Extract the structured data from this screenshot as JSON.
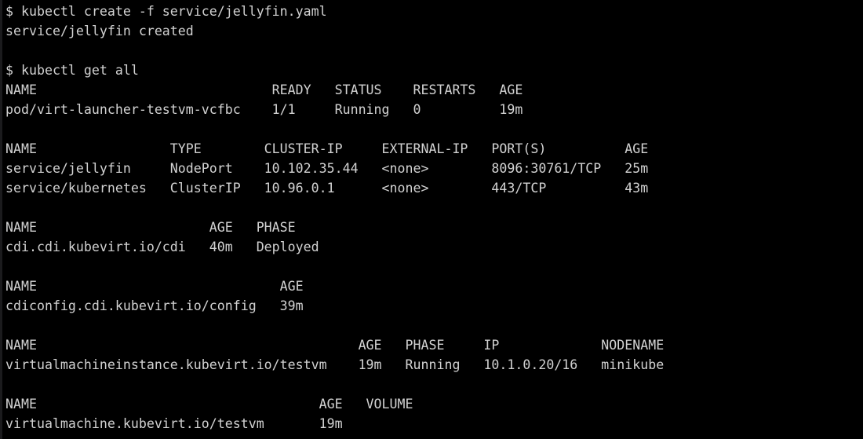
{
  "terminal": {
    "title": "kubectl terminal session",
    "background_color": "#000000",
    "foreground_color": "#d2d2d2",
    "prompt_symbol": "$",
    "columns": 96,
    "rows": 22,
    "char_width": 11.17,
    "line_height": 25
  },
  "session": {
    "commands": [
      {
        "prompt": "$",
        "command": "kubectl create -f service/jellyfin.yaml"
      },
      {
        "prompt": "$",
        "command": "kubectl get all"
      }
    ],
    "outputs": {
      "create_result": "service/jellyfin created"
    }
  },
  "lines": [
    "$ kubectl create -f service/jellyfin.yaml",
    "service/jellyfin created",
    "",
    "$ kubectl get all",
    "NAME                              READY   STATUS    RESTARTS   AGE",
    "pod/virt-launcher-testvm-vcfbc    1/1     Running   0          19m",
    "",
    "NAME                 TYPE        CLUSTER-IP     EXTERNAL-IP   PORT(S)          AGE",
    "service/jellyfin     NodePort    10.102.35.44   <none>        8096:30761/TCP   25m",
    "service/kubernetes   ClusterIP   10.96.0.1      <none>        443/TCP          43m",
    "",
    "NAME                      AGE   PHASE",
    "cdi.cdi.kubevirt.io/cdi   40m   Deployed",
    "",
    "NAME                               AGE",
    "cdiconfig.cdi.kubevirt.io/config   39m",
    "",
    "NAME                                         AGE   PHASE     IP             NODENAME",
    "virtualmachineinstance.kubevirt.io/testvm    19m   Running   10.1.0.20/16   minikube",
    "",
    "NAME                                    AGE   VOLUME",
    "virtualmachine.kubevirt.io/testvm       19m"
  ],
  "tables": {
    "pods": {
      "headers": [
        "NAME",
        "READY",
        "STATUS",
        "RESTARTS",
        "AGE"
      ],
      "rows": [
        [
          "pod/virt-launcher-testvm-vcfbc",
          "1/1",
          "Running",
          "0",
          "19m"
        ]
      ]
    },
    "services": {
      "headers": [
        "NAME",
        "TYPE",
        "CLUSTER-IP",
        "EXTERNAL-IP",
        "PORT(S)",
        "AGE"
      ],
      "rows": [
        [
          "service/jellyfin",
          "NodePort",
          "10.102.35.44",
          "<none>",
          "8096:30761/TCP",
          "25m"
        ],
        [
          "service/kubernetes",
          "ClusterIP",
          "10.96.0.1",
          "<none>",
          "443/TCP",
          "43m"
        ]
      ]
    },
    "cdi": {
      "headers": [
        "NAME",
        "AGE",
        "PHASE"
      ],
      "rows": [
        [
          "cdi.cdi.kubevirt.io/cdi",
          "40m",
          "Deployed"
        ]
      ]
    },
    "cdiconfig": {
      "headers": [
        "NAME",
        "AGE"
      ],
      "rows": [
        [
          "cdiconfig.cdi.kubevirt.io/config",
          "39m"
        ]
      ]
    },
    "virtualmachineinstances": {
      "headers": [
        "NAME",
        "AGE",
        "PHASE",
        "IP",
        "NODENAME"
      ],
      "rows": [
        [
          "virtualmachineinstance.kubevirt.io/testvm",
          "19m",
          "Running",
          "10.1.0.20/16",
          "minikube"
        ]
      ]
    },
    "virtualmachines": {
      "headers": [
        "NAME",
        "AGE",
        "VOLUME"
      ],
      "rows": [
        [
          "virtualmachine.kubevirt.io/testvm",
          "19m",
          ""
        ]
      ]
    }
  }
}
